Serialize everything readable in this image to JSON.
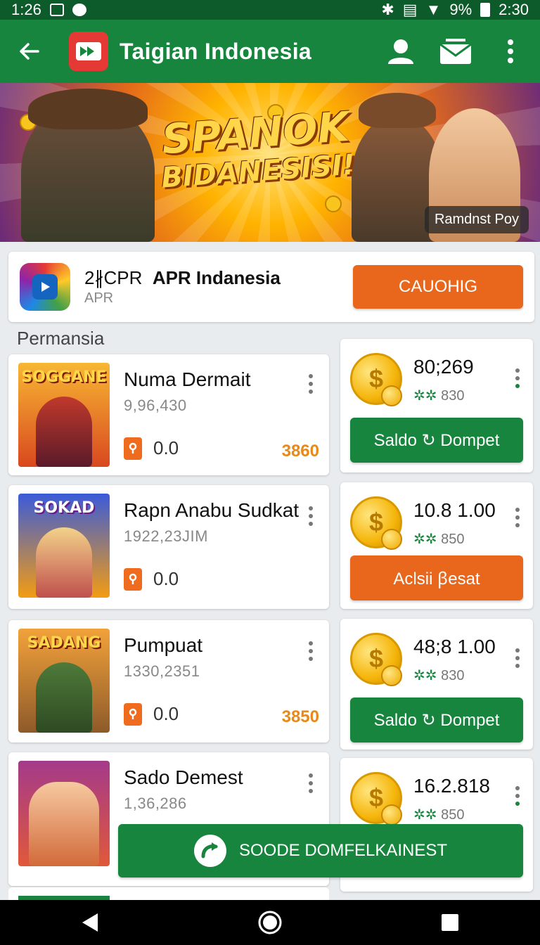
{
  "status_bar": {
    "time_left": "1:26",
    "battery": "9%",
    "time_right": "2:30"
  },
  "app_bar": {
    "title": "Taigian Indonesia"
  },
  "banner": {
    "headline_1": "SPANOK",
    "headline_2": "BIDANESISI!",
    "tag": "Ramdnst Poy"
  },
  "featured": {
    "title_prefix": "2∦CPR",
    "title_bold": "APR Indanesia",
    "subtitle": "APR",
    "button": "CAUOHIG"
  },
  "section": {
    "title": "Permansia"
  },
  "games": [
    {
      "name": "Numa Dermait",
      "sub": "9,96,430",
      "rating": "0.0",
      "count": "3860",
      "thumb_label": "SOGGANE"
    },
    {
      "name": "Rapn Anabu Sudkat",
      "sub": "1922,23JIM",
      "rating": "0.0",
      "count": "",
      "thumb_label": "SOKAD"
    },
    {
      "name": "Pumpuat",
      "sub": "1330,2351",
      "rating": "0.0",
      "count": "3850",
      "thumb_label": "SADANG"
    },
    {
      "name": "Sado Demest",
      "sub": "1,36,286",
      "rating": "",
      "count": "",
      "thumb_label": ""
    }
  ],
  "wallets": [
    {
      "amount": "80;269",
      "sub_icon": "✲✲",
      "sub": "830",
      "button": "Saldo ↻ Dompet",
      "button_color": "#17853d"
    },
    {
      "amount": "10.8 1.00",
      "sub_icon": "✲✲",
      "sub": "850",
      "button": "Aclsii ꞵesat",
      "button_color": "#e8671d"
    },
    {
      "amount": "48;8 1.00",
      "sub_icon": "✲✲",
      "sub": "830",
      "button": "Saldo ↻ Dompet",
      "button_color": "#17853d"
    },
    {
      "amount": "16.2.818",
      "sub_icon": "✲✲",
      "sub": "850",
      "button": "",
      "button_color": ""
    }
  ],
  "floating": {
    "label": "SOODE DOMFELKAINEST"
  },
  "colors": {
    "primary": "#17853d",
    "accent": "#e8671d",
    "statusbar": "#0d5a2a"
  },
  "icons": [
    "back-arrow-icon",
    "app-logo-icon",
    "profile-icon",
    "mail-icon",
    "more-vert-icon",
    "coin-icon",
    "location-pin-icon",
    "refresh-arrow-icon",
    "nav-back-icon",
    "nav-home-icon",
    "nav-recents-icon"
  ]
}
